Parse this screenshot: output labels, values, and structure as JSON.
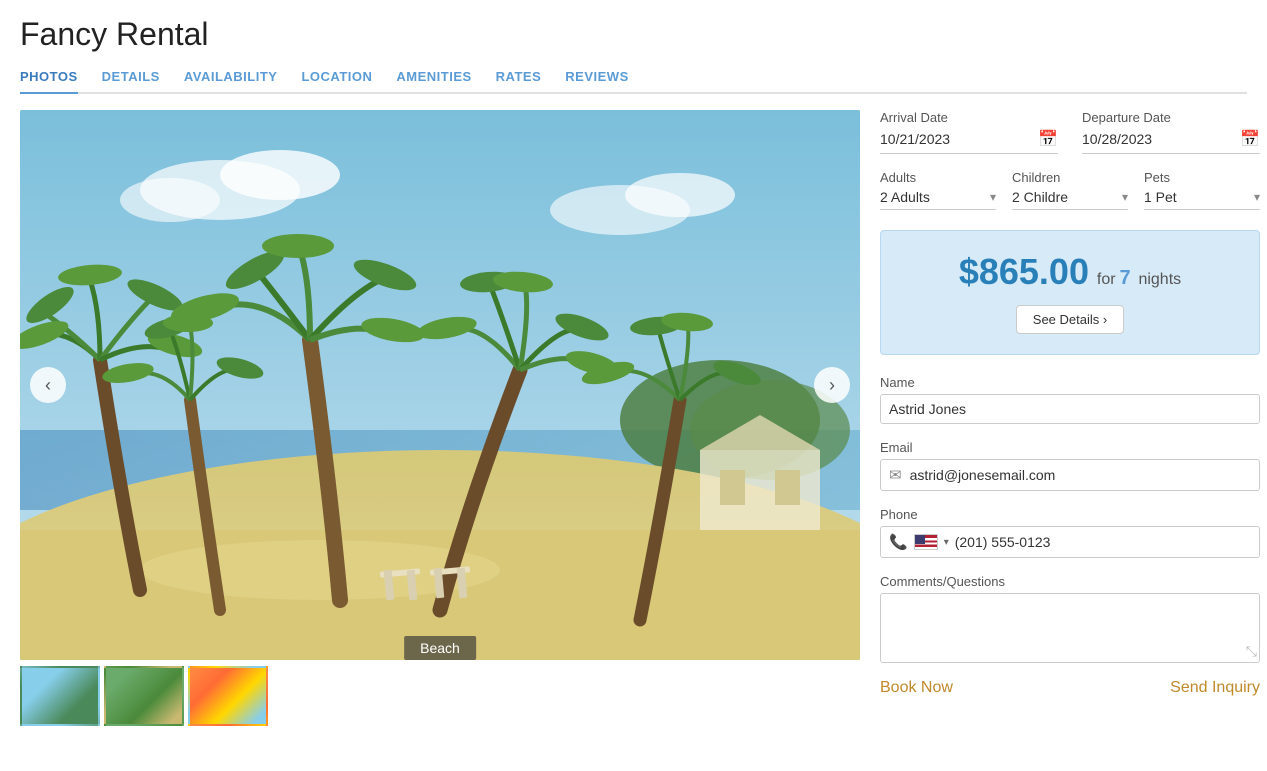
{
  "page": {
    "title": "Fancy Rental"
  },
  "nav": {
    "tabs": [
      {
        "id": "photos",
        "label": "PHOTOS"
      },
      {
        "id": "details",
        "label": "DETAILS"
      },
      {
        "id": "availability",
        "label": "AVAILABILITY"
      },
      {
        "id": "location",
        "label": "LOCATION"
      },
      {
        "id": "amenities",
        "label": "AMENITIES"
      },
      {
        "id": "rates",
        "label": "RATES"
      },
      {
        "id": "reviews",
        "label": "REVIEWS"
      }
    ]
  },
  "gallery": {
    "caption": "Beach",
    "prev_label": "‹",
    "next_label": "›"
  },
  "booking": {
    "arrival_label": "Arrival Date",
    "departure_label": "Departure Date",
    "arrival_value": "10/21/2023",
    "departure_value": "10/28/2023",
    "adults_label": "Adults",
    "children_label": "Children",
    "pets_label": "Pets",
    "adults_value": "2 Adults",
    "children_value": "2 Childre",
    "pets_value": "1 Pet",
    "price": "$865.00",
    "price_for": "for",
    "price_nights": "7",
    "price_nights_label": "nights",
    "see_details_label": "See Details ›",
    "name_label": "Name",
    "name_value": "Astrid Jones",
    "email_label": "Email",
    "email_value": "astrid@jonesemail.com",
    "phone_label": "Phone",
    "phone_value": "(201) 555-0123",
    "comments_label": "Comments/Questions",
    "book_now_label": "Book Now",
    "send_inquiry_label": "Send Inquiry"
  }
}
